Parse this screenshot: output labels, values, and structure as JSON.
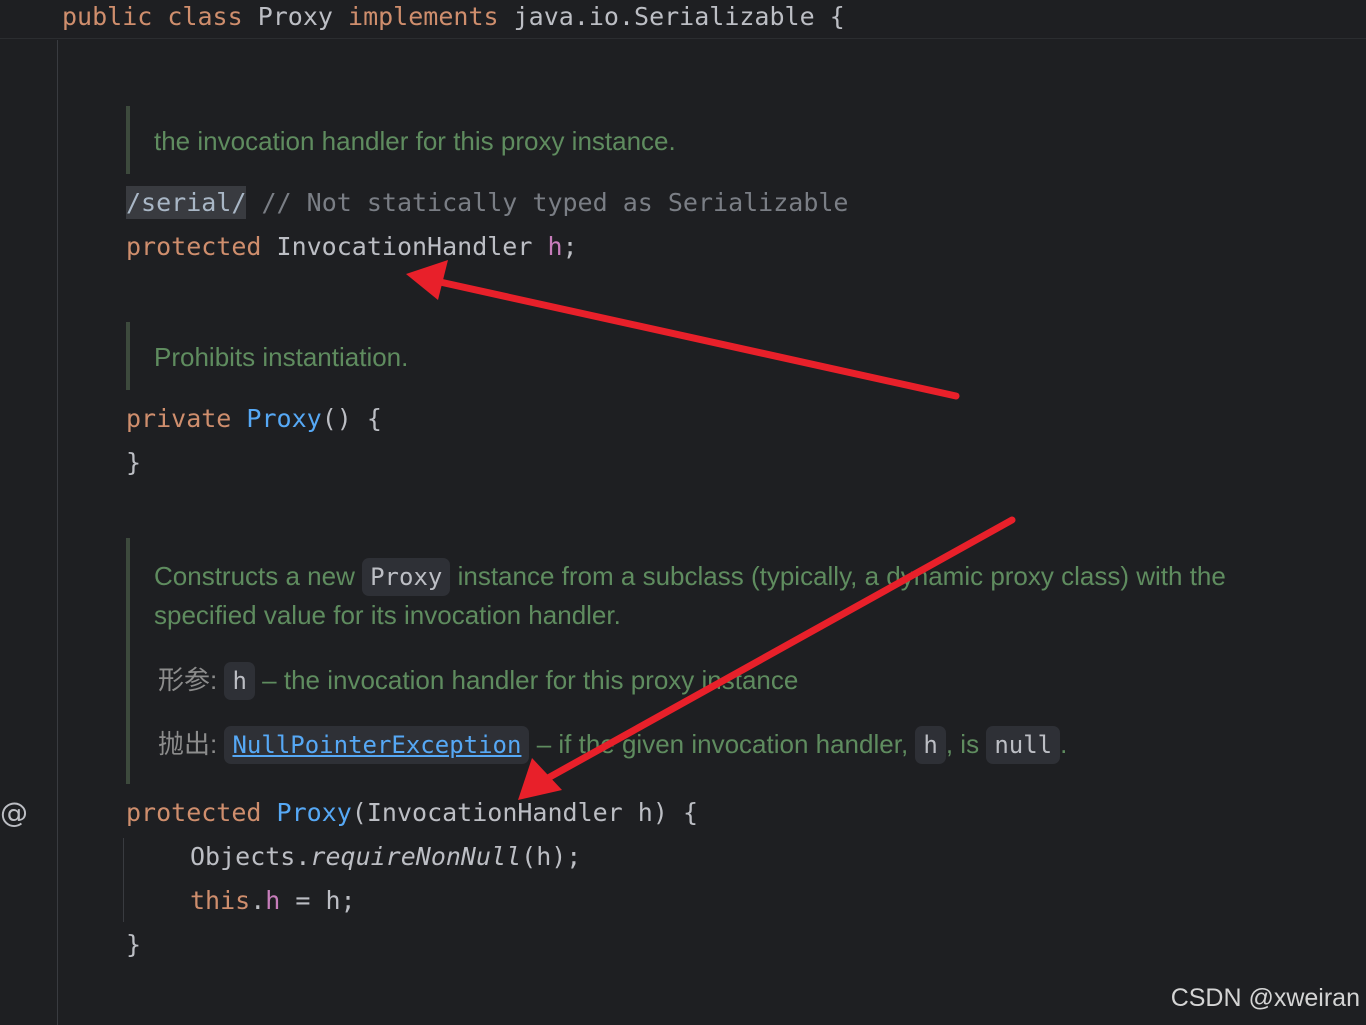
{
  "sticky_header": {
    "kw1": "public",
    "kw2": "class",
    "class_name": "Proxy",
    "kw3": "implements",
    "iface": "java.io.Serializable",
    "brace": "{"
  },
  "doc1": {
    "text": "the invocation handler for this proxy instance."
  },
  "field_decl": {
    "serial_tag": "/serial/",
    "comment": "// Not statically typed as Serializable",
    "kw": "protected",
    "type": "InvocationHandler",
    "name": "h",
    "semi": ";"
  },
  "doc2": {
    "text": "Prohibits instantiation."
  },
  "private_ctor": {
    "kw": "private",
    "name": "Proxy",
    "params": "() {",
    "close": "}"
  },
  "doc3": {
    "line1_a": "Constructs a new",
    "line1_chip": "Proxy",
    "line1_b": "instance from a subclass (typically, a dynamic proxy class) with the",
    "line2": "specified value for its invocation handler.",
    "params_label": "形参:",
    "param_chip": "h",
    "param_desc": "– the invocation handler for this proxy instance",
    "throws_label": "抛出:",
    "throws_chip": "NullPointerException",
    "throws_desc_a": "– if the given invocation handler,",
    "throws_chip2": "h",
    "throws_desc_b": ", is",
    "throws_chip3": "null",
    "throws_desc_c": "."
  },
  "protected_ctor": {
    "kw": "protected",
    "name": "Proxy",
    "params_open": "(",
    "param_type": "InvocationHandler",
    "param_name": " h) {",
    "line1_obj": "Objects.",
    "line1_method": "requireNonNull",
    "line1_args": "(h);",
    "line2_this": "this",
    "line2_dot": ".",
    "line2_field": "h",
    "line2_rest": " = h;",
    "close": "}"
  },
  "gutter_icon": "@",
  "watermark": "CSDN @xweiran",
  "annotation_color": "#e8202a"
}
